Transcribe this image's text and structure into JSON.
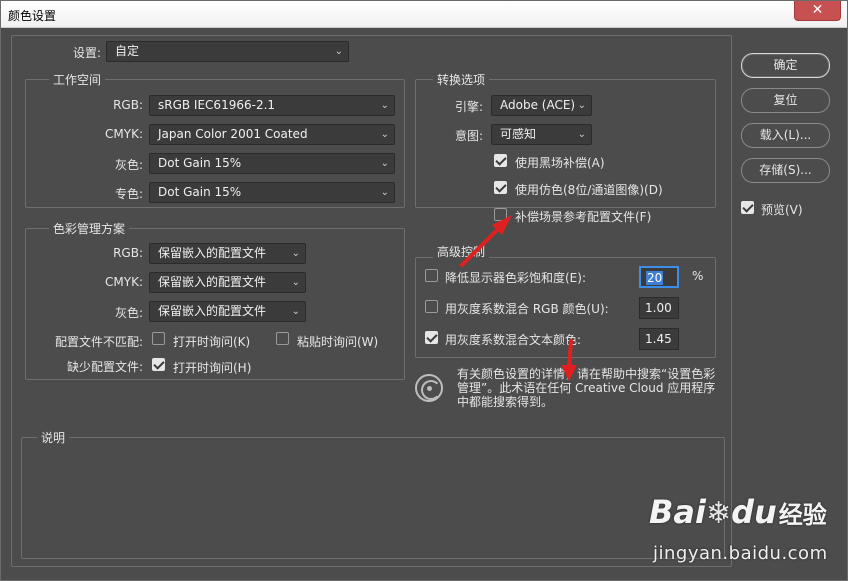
{
  "window": {
    "title": "颜色设置",
    "close_icon": "✕"
  },
  "settings": {
    "label": "设置:",
    "value": "自定"
  },
  "workspace": {
    "title": "工作空间",
    "rows": [
      {
        "label": "RGB:",
        "value": "sRGB IEC61966-2.1"
      },
      {
        "label": "CMYK:",
        "value": "Japan Color 2001 Coated"
      },
      {
        "label": "灰色:",
        "value": "Dot Gain 15%"
      },
      {
        "label": "专色:",
        "value": "Dot Gain 15%"
      }
    ]
  },
  "policy": {
    "title": "色彩管理方案",
    "rows": [
      {
        "label": "RGB:",
        "value": "保留嵌入的配置文件"
      },
      {
        "label": "CMYK:",
        "value": "保留嵌入的配置文件"
      },
      {
        "label": "灰色:",
        "value": "保留嵌入的配置文件"
      }
    ],
    "mismatch_label": "配置文件不匹配:",
    "ask_open": {
      "label": "打开时询问(K)",
      "checked": false
    },
    "ask_paste": {
      "label": "粘贴时询问(W)",
      "checked": false
    },
    "missing_label": "缺少配置文件:",
    "missing_ask_open": {
      "label": "打开时询问(H)",
      "checked": true
    }
  },
  "conversion": {
    "title": "转换选项",
    "engine_label": "引擎:",
    "engine_value": "Adobe (ACE)",
    "intent_label": "意图:",
    "intent_value": "可感知",
    "options": [
      {
        "label": "使用黑场补偿(A)",
        "checked": true
      },
      {
        "label": "使用仿色(8位/通道图像)(D)",
        "checked": true
      },
      {
        "label": "补偿场景参考配置文件(F)",
        "checked": false
      }
    ]
  },
  "advanced": {
    "title": "高级控制",
    "desaturate": {
      "label": "降低显示器色彩饱和度(E):",
      "checked": false,
      "value": "20",
      "unit": "%"
    },
    "blend_rgb": {
      "label": "用灰度系数混合 RGB 颜色(U):",
      "checked": false,
      "value": "1.00"
    },
    "blend_text": {
      "label": "用灰度系数混合文本颜色:",
      "checked": true,
      "value": "1.45"
    }
  },
  "info": {
    "icon": "color-wheel-icon",
    "text": "有关颜色设置的详情，请在帮助中搜索“设置色彩管理”。此术语在任何 Creative Cloud 应用程序中都能搜索得到。"
  },
  "description": {
    "title": "说明"
  },
  "buttons": {
    "ok": "确定",
    "reset": "复位",
    "load": "载入(L)...",
    "save": "存储(S)..."
  },
  "preview": {
    "label": "预览(V)",
    "checked": true
  },
  "watermark": {
    "logo_a": "Bai",
    "logo_b": "du",
    "cn": "经验",
    "url": "jingyan.baidu.com"
  },
  "colors": {
    "panel": "#4c4c4c",
    "field": "#3b3b3b",
    "focus": "#3d8ee6",
    "arrow": "#e02020"
  }
}
